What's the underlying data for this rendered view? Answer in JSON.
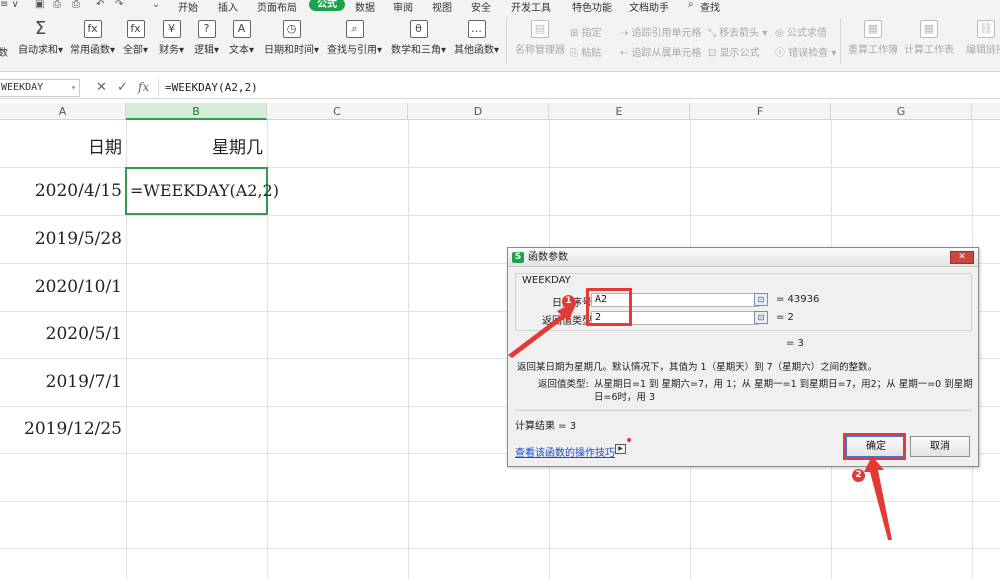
{
  "menubar": {
    "quick_access": [
      "≡ ∨",
      "💾",
      "🖨",
      "🖨",
      "↶",
      "↷",
      "⌄"
    ],
    "items": [
      "开始",
      "插入",
      "页面布局",
      "公式",
      "数据",
      "审阅",
      "视图",
      "安全",
      "开发工具",
      "特色功能",
      "文档助手"
    ],
    "active": "公式",
    "search": "查找"
  },
  "ribbon": {
    "insert_fn_partial": "数",
    "buttons": [
      {
        "label": "自动求和",
        "icon": "Σ"
      },
      {
        "label": "常用函数",
        "icon": "fx"
      },
      {
        "label": "全部",
        "icon": "fx"
      },
      {
        "label": "财务",
        "icon": "¥"
      },
      {
        "label": "逻辑",
        "icon": "?"
      },
      {
        "label": "文本",
        "icon": "A"
      },
      {
        "label": "日期和时间",
        "icon": "◷"
      },
      {
        "label": "查找与引用",
        "icon": "🔍"
      },
      {
        "label": "数学和三角",
        "icon": "θ"
      },
      {
        "label": "其他函数",
        "icon": "…"
      }
    ],
    "disabled_buttons": [
      "名称管理器",
      "重算工作簿",
      "计算工作表",
      "编辑链接"
    ],
    "small": {
      "specify": "指定",
      "paste": "粘贴",
      "trace_precedents": "追踪引用单元格",
      "trace_dependents": "追踪从属单元格",
      "remove_arrows": "移去箭头",
      "show_formulas": "显示公式",
      "formula_eval": "公式求值",
      "error_check": "错误检查"
    }
  },
  "formula_bar": {
    "name_box": "WEEKDAY",
    "cancel_icon": "✕",
    "enter_icon": "✓",
    "fx_icon": "fx",
    "formula": "=WEEKDAY(A2,2)"
  },
  "columns": [
    "A",
    "B",
    "C",
    "D",
    "E",
    "F",
    "G"
  ],
  "selected_column": "B",
  "sheet": {
    "header_a": "日期",
    "header_b": "星期几",
    "dates": [
      "2020/4/15",
      "2019/5/28",
      "2020/10/1",
      "2020/5/1",
      "2019/7/1",
      "2019/12/25"
    ],
    "active_cell_text": "=WEEKDAY(A2,2)"
  },
  "dialog": {
    "title": "函数参数",
    "logo": "S",
    "close_icon": "✕",
    "function_name": "WEEKDAY",
    "args": [
      {
        "label": "日期序号",
        "value": "A2",
        "result": "= 43936"
      },
      {
        "label": "返回值类型",
        "value": "2",
        "result": "= 2"
      }
    ],
    "formula_result_line": "= 3",
    "description": "返回某日期为星期几。默认情况下，其值为 1（星期天）到 7（星期六）之间的整数。",
    "arg_help_label": "返回值类型:",
    "arg_help_text": "从星期日=1 到 星期六=7，用 1；从 星期一=1 到星期日=7，用2；从 星期一=0 到星期日=6时，用 3",
    "calc_result": "计算结果 = 3",
    "help_link": "查看该函数的操作技巧",
    "ok": "确定",
    "cancel": "取消"
  },
  "annotations": {
    "marker1": "1",
    "marker2": "2",
    "color": "#e53935"
  }
}
